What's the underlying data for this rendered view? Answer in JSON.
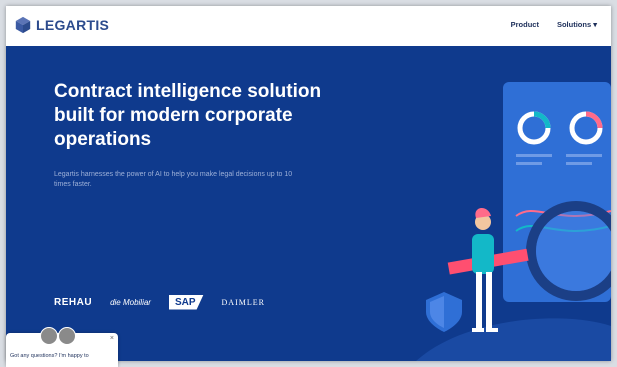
{
  "header": {
    "brand": "LEGARTIS",
    "nav": {
      "product": "Product",
      "solutions": "Solutions"
    }
  },
  "hero": {
    "title": "Contract intelligence solution built for modern corporate operations",
    "subtitle": "Legartis harnesses the power of AI to help you make legal decisions up to 10 times faster."
  },
  "clients": {
    "rehau": "REHAU",
    "mobiliar": "die Mobiliar",
    "sap": "SAP",
    "daimler": "DAIMLER"
  },
  "chat": {
    "text": "Got any questions? I'm happy to",
    "close": "×"
  },
  "colors": {
    "hero_bg": "#0f3a8d",
    "accent": "#13b8c8",
    "accent_pink": "#ff6b8a"
  }
}
